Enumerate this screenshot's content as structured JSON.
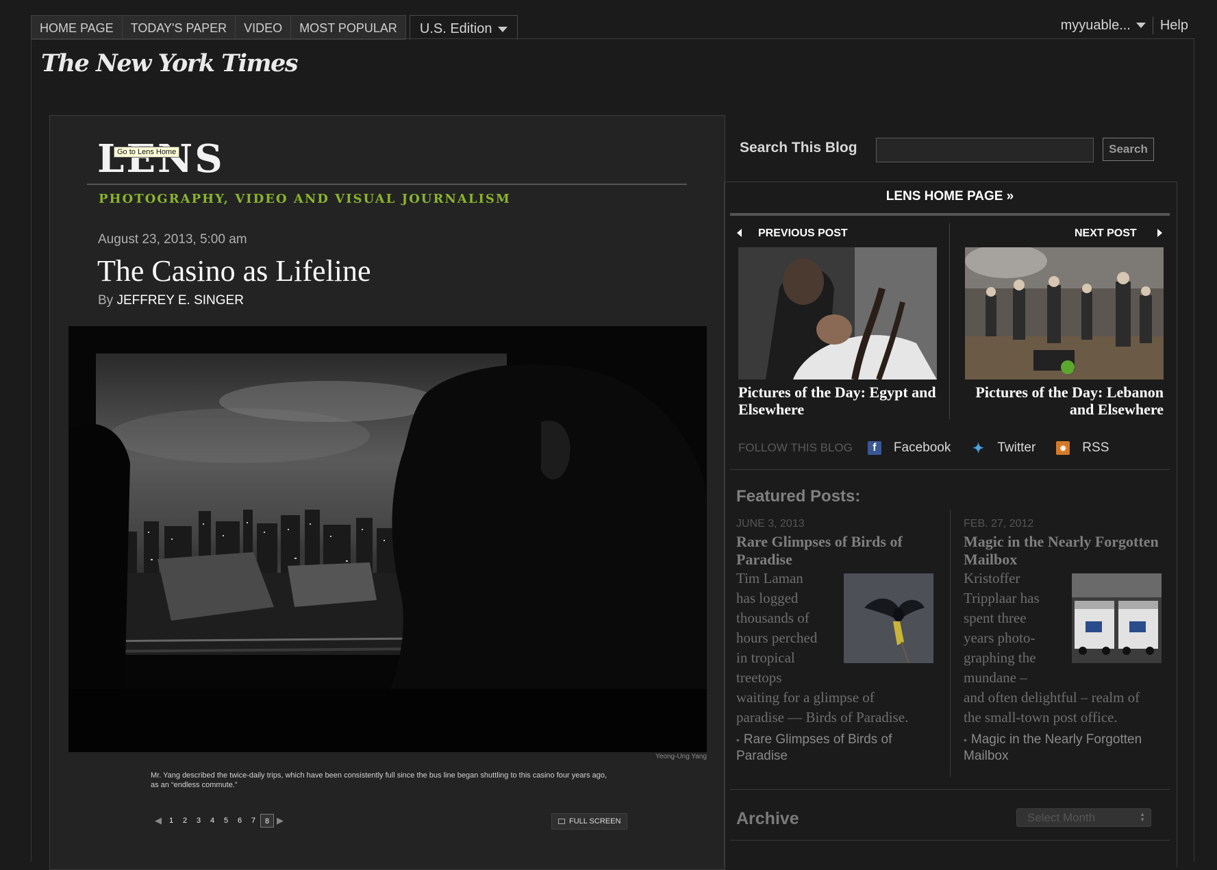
{
  "nav": {
    "tabs": [
      "HOME PAGE",
      "TODAY'S PAPER",
      "VIDEO",
      "MOST POPULAR"
    ],
    "edition": "U.S. Edition"
  },
  "user": {
    "name": "myyuable...",
    "help": "Help"
  },
  "masthead": "The New York Times",
  "lens": {
    "logo": "LENS",
    "tooltip": "Go to Lens Home",
    "tagline": "PHOTOGRAPHY, VIDEO AND VISUAL JOURNALISM"
  },
  "post": {
    "date": "August 23, 2013, 5:00 am",
    "title": "The Casino as Lifeline",
    "by": "By",
    "author": "JEFFREY E. SINGER",
    "photo_credit": "Yeong-Ung Yang",
    "caption": "Mr. Yang described the twice-daily trips, which have been consistently full since the bus line began shuttling to this casino four years ago, as an “endless commute.”",
    "pages": [
      "1",
      "2",
      "3",
      "4",
      "5",
      "6",
      "7",
      "8"
    ],
    "current_page": "8",
    "fullscreen": "FULL SCREEN"
  },
  "sidebar": {
    "search_label": "Search This Blog",
    "search_placeholder": "",
    "search_button": "Search",
    "home_link": "LENS HOME PAGE »",
    "prev_label": "PREVIOUS POST",
    "next_label": "NEXT POST",
    "prev_title": "Pictures of the Day: Egypt and Elsewhere",
    "next_title": "Pictures of the Day: Lebanon and Elsewhere",
    "follow": {
      "label": "FOLLOW THIS BLOG",
      "links": [
        "Facebook",
        "Twitter",
        "RSS"
      ]
    },
    "featured_heading": "Featured Posts:",
    "featured": [
      {
        "date": "JUNE 3, 2013",
        "title": "Rare Glimpses of Birds of Paradise",
        "lines": [
          "Tim Laman",
          "has logged",
          "thousands of",
          "hours perched",
          "in tropical",
          "treetops"
        ],
        "tail": [
          "waiting for a glimpse of",
          "paradise — Birds of Paradise."
        ],
        "link": "Rare Glimpses of Birds of Paradise"
      },
      {
        "date": "FEB. 27, 2012",
        "title": "Magic in the Nearly Forgotten Mailbox",
        "lines": [
          "Kristoffer",
          "Tripplaar has",
          "spent three",
          "years photo-",
          "graphing the",
          "mundane –"
        ],
        "tail": [
          "and often delightful – realm of",
          "the small-town post office."
        ],
        "link": "Magic in the Nearly Forgotten Mailbox"
      }
    ],
    "archive_label": "Archive",
    "archive_select": "Select Month"
  },
  "icons": {
    "edition_caret": "caret-down-icon",
    "user_caret": "caret-down-icon",
    "prev": "triangle-left-icon",
    "next": "triangle-right-icon",
    "facebook": "facebook-icon",
    "twitter": "twitter-icon",
    "rss": "rss-icon",
    "fullscreen": "fullscreen-icon"
  },
  "colors": {
    "background": "#1b1b1b",
    "tagline_green": "#8bb52a",
    "facebook_blue": "#3a5795",
    "twitter_blue": "#4aa3df",
    "rss_orange": "#d37a2a"
  }
}
